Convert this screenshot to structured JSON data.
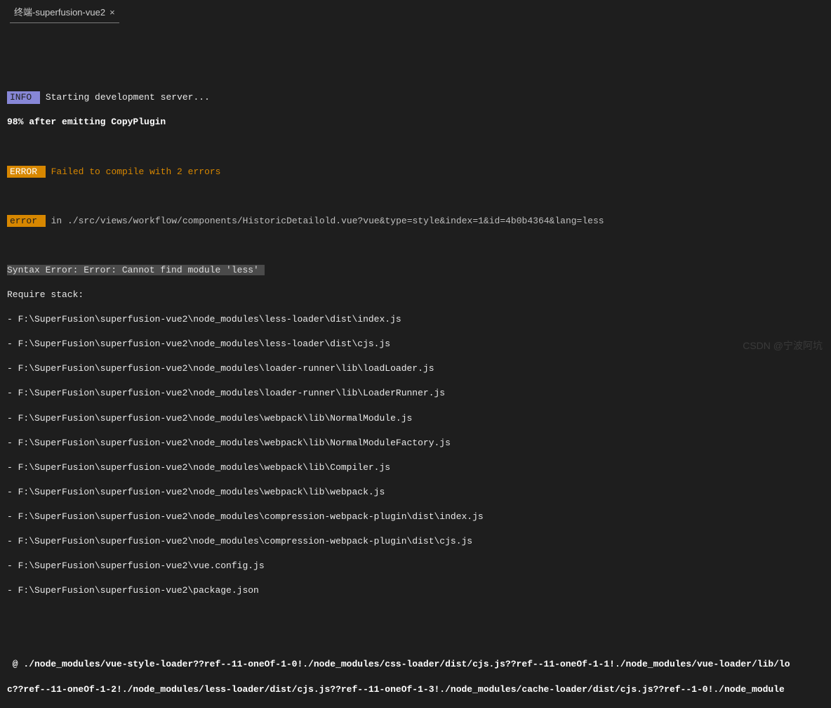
{
  "tab": {
    "title": "终端-superfusion-vue2",
    "close": "×"
  },
  "badges": {
    "info": "INFO",
    "ERROR": "ERROR",
    "error": "error"
  },
  "msg": {
    "starting": " Starting development server...",
    "progress": "98% after emitting CopyPlugin",
    "failed": " Failed to compile with 2 errors",
    "errorin": " in ./src/views/workflow/components/HistoricDetailold.vue?vue&type=style&index=1&id=4b0b4364&lang=less",
    "syntax": "Syntax Error: Error: Cannot find module 'less' ",
    "require": "Require stack:"
  },
  "stack": [
    "- F:\\SuperFusion\\superfusion-vue2\\node_modules\\less-loader\\dist\\index.js",
    "- F:\\SuperFusion\\superfusion-vue2\\node_modules\\less-loader\\dist\\cjs.js",
    "- F:\\SuperFusion\\superfusion-vue2\\node_modules\\loader-runner\\lib\\loadLoader.js",
    "- F:\\SuperFusion\\superfusion-vue2\\node_modules\\loader-runner\\lib\\LoaderRunner.js",
    "- F:\\SuperFusion\\superfusion-vue2\\node_modules\\webpack\\lib\\NormalModule.js",
    "- F:\\SuperFusion\\superfusion-vue2\\node_modules\\webpack\\lib\\NormalModuleFactory.js",
    "- F:\\SuperFusion\\superfusion-vue2\\node_modules\\webpack\\lib\\Compiler.js",
    "- F:\\SuperFusion\\superfusion-vue2\\node_modules\\webpack\\lib\\webpack.js",
    "- F:\\SuperFusion\\superfusion-vue2\\node_modules\\compression-webpack-plugin\\dist\\index.js",
    "- F:\\SuperFusion\\superfusion-vue2\\node_modules\\compression-webpack-plugin\\dist\\cjs.js",
    "- F:\\SuperFusion\\superfusion-vue2\\vue.config.js",
    "- F:\\SuperFusion\\superfusion-vue2\\package.json"
  ],
  "footer": {
    "l1": " @ ./node_modules/vue-style-loader??ref--11-oneOf-1-0!./node_modules/css-loader/dist/cjs.js??ref--11-oneOf-1-1!./node_modules/vue-loader/lib/lo",
    "l2": "c??ref--11-oneOf-1-2!./node_modules/less-loader/dist/cjs.js??ref--11-oneOf-1-3!./node_modules/cache-loader/dist/cjs.js??ref--1-0!./node_module"
  },
  "watermark": "CSDN @宁波阿坑"
}
